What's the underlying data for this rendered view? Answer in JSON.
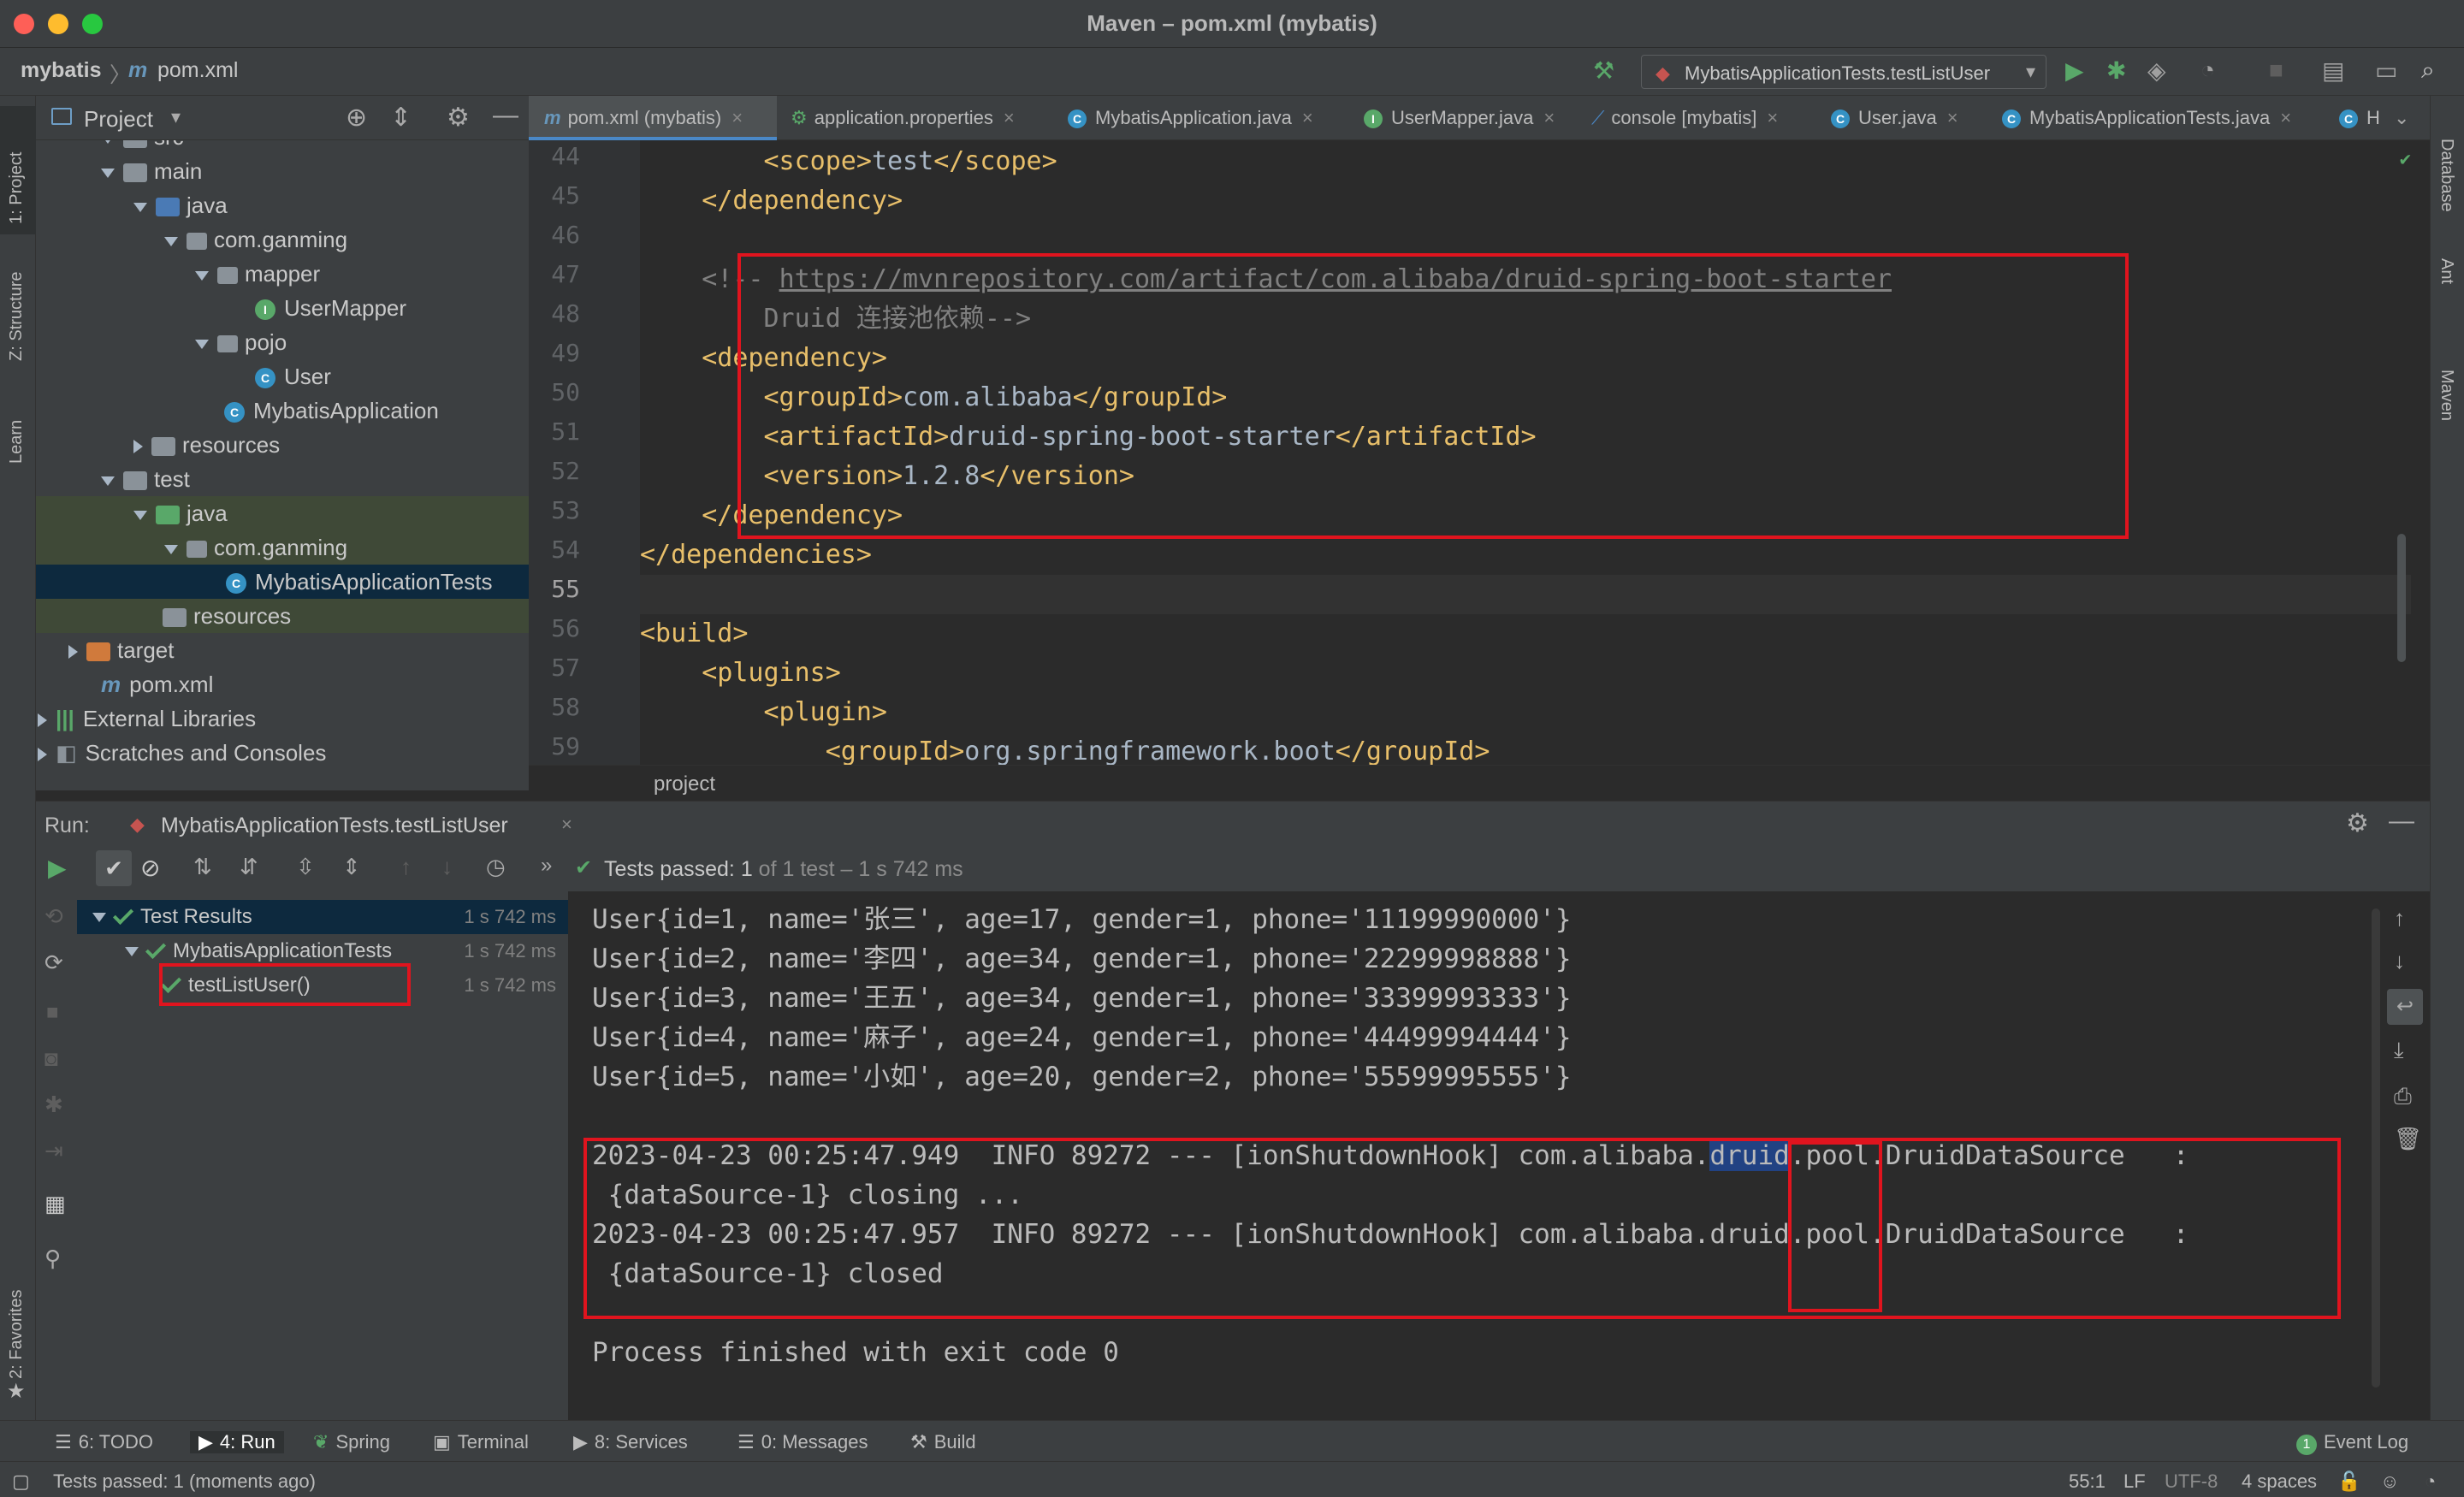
{
  "window": {
    "title": "Maven – pom.xml (mybatis)"
  },
  "nav": {
    "project": "mybatis",
    "file": "pom.xml",
    "run_config": "MybatisApplicationTests.testListUser"
  },
  "project_panel": {
    "title": "Project",
    "tree": [
      {
        "label": "src",
        "indent": 0
      },
      {
        "label": "main",
        "indent": 1
      },
      {
        "label": "java",
        "indent": 2
      },
      {
        "label": "com.ganming",
        "indent": 3
      },
      {
        "label": "mapper",
        "indent": 4
      },
      {
        "label": "UserMapper",
        "indent": 5
      },
      {
        "label": "pojo",
        "indent": 4
      },
      {
        "label": "User",
        "indent": 5
      },
      {
        "label": "MybatisApplication",
        "indent": 4
      },
      {
        "label": "resources",
        "indent": 2
      },
      {
        "label": "test",
        "indent": 1
      },
      {
        "label": "java",
        "indent": 2
      },
      {
        "label": "com.ganming",
        "indent": 3
      },
      {
        "label": "MybatisApplicationTests",
        "indent": 4
      },
      {
        "label": "resources",
        "indent": 2
      },
      {
        "label": "target",
        "indent": 1
      },
      {
        "label": "pom.xml",
        "indent": 1
      },
      {
        "label": "External Libraries",
        "indent": 0
      },
      {
        "label": "Scratches and Consoles",
        "indent": 0
      }
    ]
  },
  "left_stripe": {
    "project": "1: Project",
    "structure": "Z: Structure",
    "learn": "Learn",
    "favorites": "2: Favorites"
  },
  "right_stripe": {
    "database": "Database",
    "ant": "Ant",
    "maven": "Maven"
  },
  "editor": {
    "tabs": [
      "pom.xml (mybatis)",
      "application.properties",
      "MybatisApplication.java",
      "UserMapper.java",
      "console [mybatis]",
      "User.java",
      "MybatisApplicationTests.java",
      "H"
    ],
    "active_tab": "pom.xml (mybatis)",
    "line_numbers": [
      "44",
      "45",
      "46",
      "47",
      "48",
      "49",
      "50",
      "51",
      "52",
      "53",
      "54",
      "55",
      "56",
      "57",
      "58",
      "59"
    ],
    "lines": [
      "        <scope>test</scope>",
      "    </dependency>",
      "",
      "    <!-- https://mvnrepository.com/artifact/com.alibaba/druid-spring-boot-starter",
      "        Druid 连接池依赖-->",
      "    <dependency>",
      "        <groupId>com.alibaba</groupId>",
      "        <artifactId>druid-spring-boot-starter</artifactId>",
      "        <version>1.2.8</version>",
      "    </dependency>",
      "</dependencies>",
      "",
      "<build>",
      "    <plugins>",
      "        <plugin>",
      "            <groupId>org.springframework.boot</groupId>"
    ],
    "breadcrumb": "project"
  },
  "run": {
    "label": "Run:",
    "config": "MybatisApplicationTests.testListUser",
    "status_prefix": "Tests passed:",
    "status_count": "1",
    "status_suffix": "of 1 test – 1 s 742 ms",
    "tree": [
      {
        "label": "Test Results",
        "time": "1 s 742 ms"
      },
      {
        "label": "MybatisApplicationTests",
        "time": "1 s 742 ms"
      },
      {
        "label": "testListUser()",
        "time": "1 s 742 ms"
      }
    ],
    "console": [
      "User{id=1, name='张三', age=17, gender=1, phone='11199990000'}",
      "User{id=2, name='李四', age=34, gender=1, phone='22299998888'}",
      "User{id=3, name='王五', age=34, gender=1, phone='33399993333'}",
      "User{id=4, name='麻子', age=24, gender=1, phone='44499994444'}",
      "User{id=5, name='小如', age=20, gender=2, phone='55599995555'}",
      "",
      "2023-04-23 00:25:47.949  INFO 89272 --- [ionShutdownHook] com.alibaba.druid.pool.DruidDataSource   :",
      " {dataSource-1} closing ...",
      "2023-04-23 00:25:47.957  INFO 89272 --- [ionShutdownHook] com.alibaba.druid.pool.DruidDataSource   :",
      " {dataSource-1} closed",
      "",
      "Process finished with exit code 0"
    ]
  },
  "tool_windows": [
    "6: TODO",
    "4: Run",
    "Spring",
    "Terminal",
    "8: Services",
    "0: Messages",
    "Build",
    "Event Log"
  ],
  "status": {
    "message": "Tests passed: 1 (moments ago)",
    "position": "55:1",
    "line_sep": "LF",
    "encoding": "UTF-8",
    "indent": "4 spaces"
  },
  "colors": {
    "accent": "#4a88c7",
    "highlight_box": "#e0141e",
    "pass": "#59a869"
  }
}
